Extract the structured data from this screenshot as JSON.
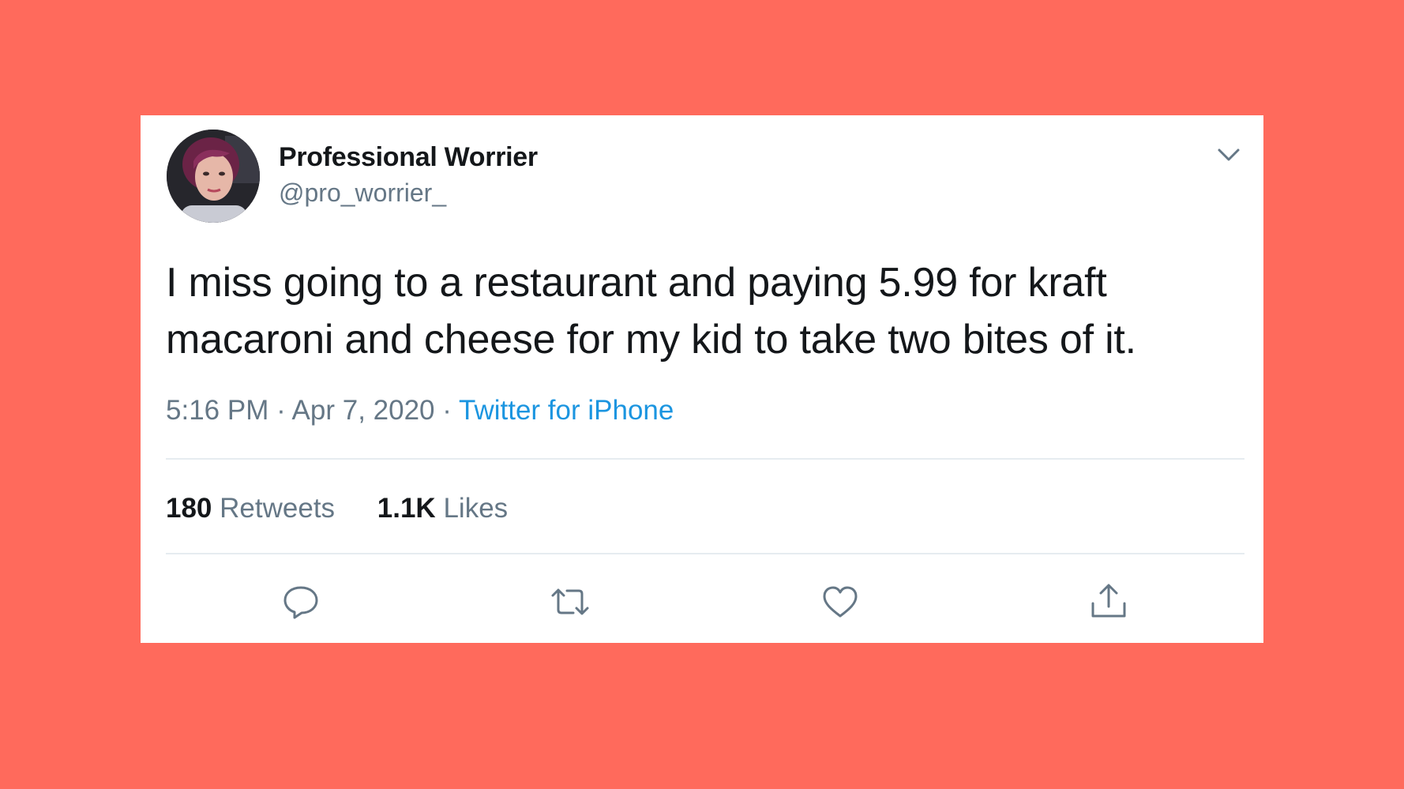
{
  "tweet": {
    "author": {
      "display_name": "Professional Worrier",
      "handle": "@pro_worrier_"
    },
    "text_lines": [
      "I miss going to a restaurant and paying 5.99 for kraft",
      "macaroni and cheese for my kid to take two bites of it."
    ],
    "time": "5:16 PM",
    "separator": "·",
    "date": "Apr 7, 2020",
    "source": "Twitter for iPhone",
    "stats": {
      "retweets_count": "180",
      "retweets_label": "Retweets",
      "likes_count": "1.1K",
      "likes_label": "Likes"
    }
  },
  "icons": {
    "menu": "chevron-down-icon",
    "reply": "reply-icon",
    "retweet": "retweet-icon",
    "like": "heart-icon",
    "share": "share-icon"
  },
  "colors": {
    "background": "#FF6A5C",
    "card": "#FFFFFF",
    "text": "#14171A",
    "secondary": "#657786",
    "link": "#1B95E0"
  }
}
